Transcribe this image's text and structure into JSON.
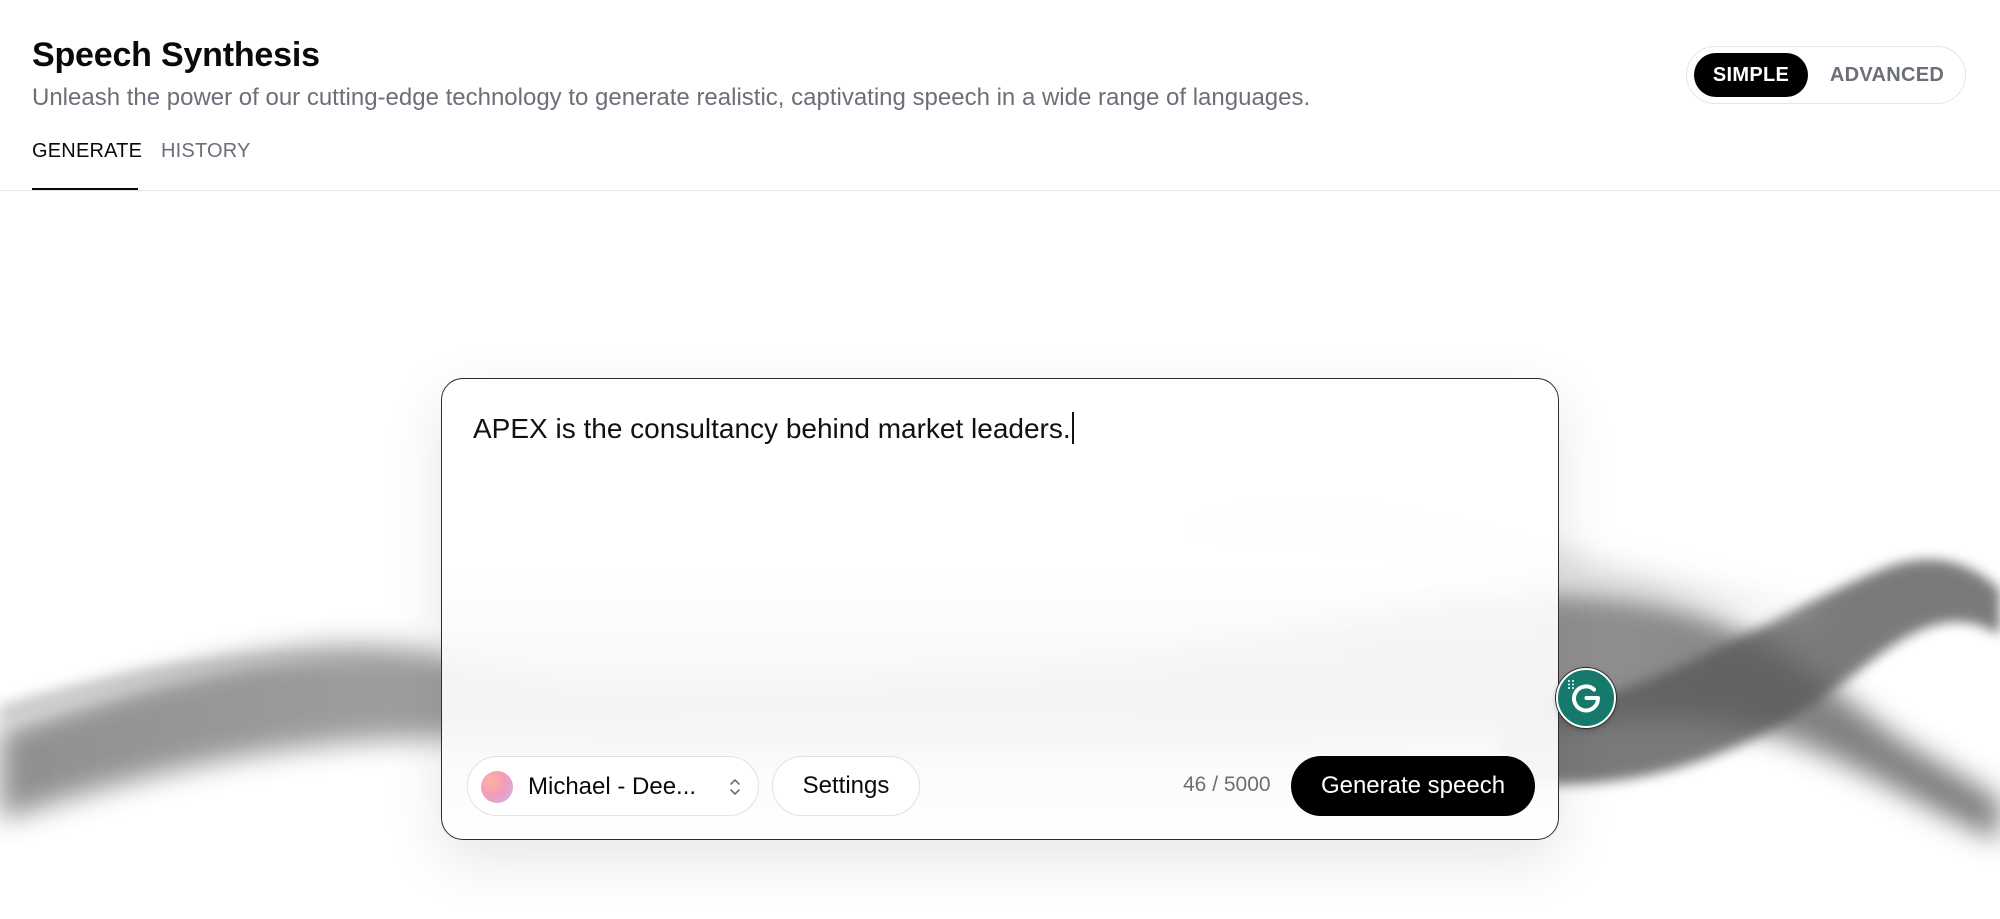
{
  "header": {
    "title": "Speech Synthesis",
    "subtitle": "Unleash the power of our cutting-edge technology to generate realistic, captivating speech in a wide range of languages."
  },
  "mode_toggle": {
    "options": [
      "SIMPLE",
      "ADVANCED"
    ],
    "selected": "SIMPLE"
  },
  "tabs": [
    {
      "label": "GENERATE",
      "active": true
    },
    {
      "label": "HISTORY",
      "active": false
    }
  ],
  "editor": {
    "text": "APEX is the consultancy behind market leaders.",
    "char_count": "46 / 5000"
  },
  "voice": {
    "label": "Michael - Dee...",
    "avatar_icon": "gradient-orb"
  },
  "settings_label": "Settings",
  "generate_label": "Generate speech",
  "grammarly": {
    "icon": "grammarly-icon",
    "color": "#15796b"
  },
  "colors": {
    "primary": "#000000",
    "muted_text": "#6b6f78",
    "border": "#e6e6e9"
  }
}
